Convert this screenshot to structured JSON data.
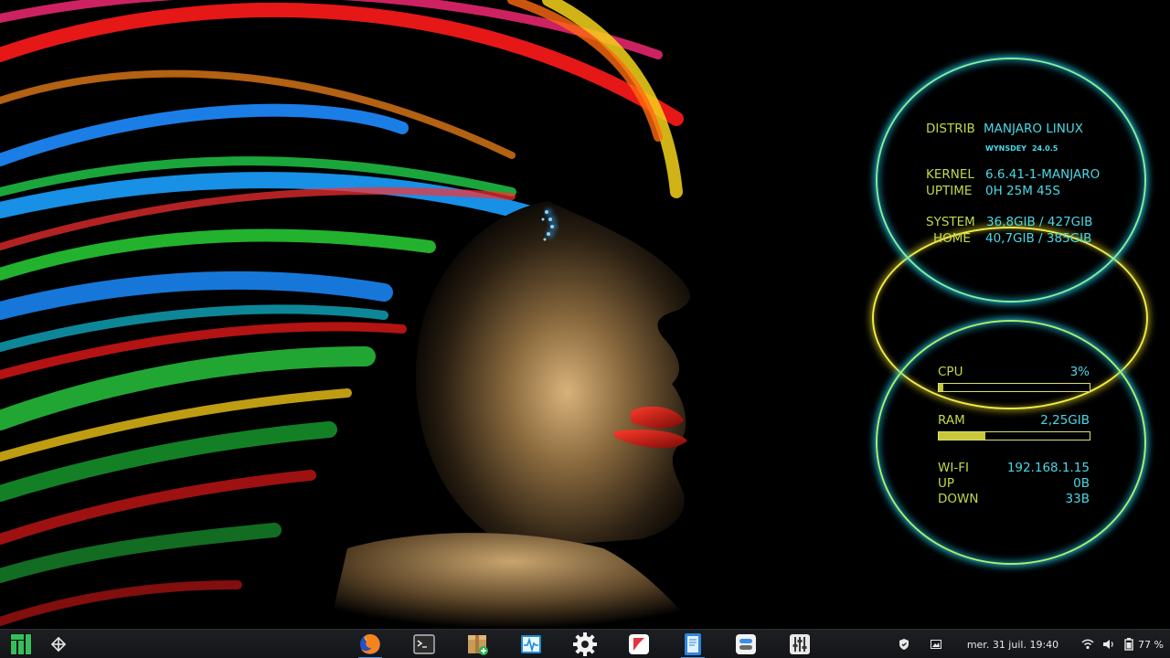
{
  "conky": {
    "info": {
      "distrib_label": "DISTRIB",
      "distrib_value": "MANJARO LINUX",
      "codename": "WYNSDEY",
      "version": "24.0.5",
      "kernel_label": "KERNEL",
      "kernel_value": "6.6.41-1-MANJARO",
      "uptime_label": "UPTIME",
      "uptime_value": "0H 25M 45S",
      "system_label": "SYSTEM",
      "system_value": "36,8GIB / 427GIB",
      "home_label": "HOME",
      "home_value": "40,7GIB / 385GIB"
    },
    "stats": {
      "cpu_label": "CPU",
      "cpu_value": "3%",
      "cpu_fraction": 0.03,
      "ram_label": "RAM",
      "ram_value": "2,25GIB",
      "ram_fraction": 0.31,
      "wifi_label": "WI-FI",
      "wifi_value": "192.168.1.15",
      "up_label": "UP",
      "up_value": "0B",
      "down_label": "DOWN",
      "down_value": "33B"
    },
    "colors": {
      "label": "#c4d84a",
      "value": "#4ad8e8",
      "ring_cyan": "#28dcff",
      "ring_yellow": "#f2ea4a"
    }
  },
  "taskbar": {
    "launchers": [
      {
        "name": "manjaro-menu-icon"
      },
      {
        "name": "workspace-switcher-icon"
      }
    ],
    "apps": [
      {
        "name": "firefox-icon",
        "active": true
      },
      {
        "name": "terminal-icon",
        "active": false
      },
      {
        "name": "package-manager-icon",
        "active": false
      },
      {
        "name": "system-monitor-icon",
        "active": false
      },
      {
        "name": "settings-gear-icon",
        "active": false
      },
      {
        "name": "flatpak-store-icon",
        "active": false
      },
      {
        "name": "text-editor-icon",
        "active": true
      },
      {
        "name": "software-center-icon",
        "active": false
      },
      {
        "name": "mixer-settings-icon",
        "active": false
      }
    ],
    "tray": {
      "datetime": "mer. 31 juil.  19:40",
      "battery": "77 %",
      "icons": [
        "shield-icon",
        "screen-icon",
        "wifi-icon",
        "volume-icon",
        "battery-icon"
      ]
    }
  }
}
